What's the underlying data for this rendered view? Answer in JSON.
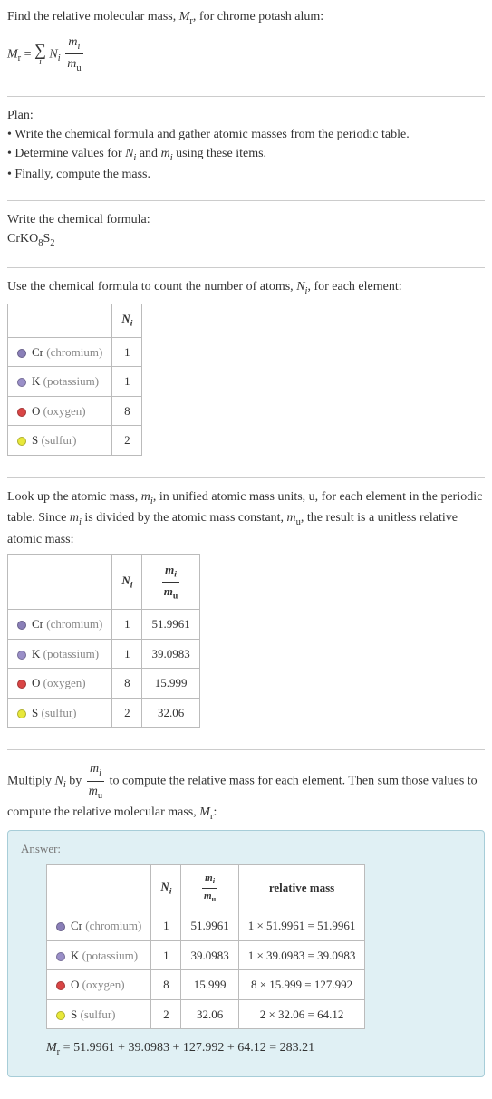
{
  "intro": {
    "line1_pre": "Find the relative molecular mass, ",
    "line1_var": "M",
    "line1_sub": "r",
    "line1_post": ", for chrome potash alum:"
  },
  "plan": {
    "heading": "Plan:",
    "item1": "• Write the chemical formula and gather atomic masses from the periodic table.",
    "item2_pre": "• Determine values for ",
    "item2_mid": " and ",
    "item2_post": " using these items.",
    "item3": "• Finally, compute the mass."
  },
  "chemformula": {
    "heading": "Write the chemical formula:",
    "formula_text": "CrKO",
    "sub1": "8",
    "s": "S",
    "sub2": "2"
  },
  "count_section": {
    "text_pre": "Use the chemical formula to count the number of atoms, ",
    "text_post": ", for each element:"
  },
  "elements": [
    {
      "sym": "Cr",
      "name": "(chromium)",
      "color": "#8a7fb8",
      "N": "1",
      "mass": "51.9961",
      "rel": "1 × 51.9961 = 51.9961"
    },
    {
      "sym": "K",
      "name": "(potassium)",
      "color": "#9a8fc8",
      "N": "1",
      "mass": "39.0983",
      "rel": "1 × 39.0983 = 39.0983"
    },
    {
      "sym": "O",
      "name": "(oxygen)",
      "color": "#d94545",
      "N": "8",
      "mass": "15.999",
      "rel": "8 × 15.999 = 127.992"
    },
    {
      "sym": "S",
      "name": "(sulfur)",
      "color": "#e8e83a",
      "N": "2",
      "mass": "32.06",
      "rel": "2 × 32.06 = 64.12"
    }
  ],
  "lookup_section": {
    "text_pre": "Look up the atomic mass, ",
    "text_mid1": ", in unified atomic mass units, u, for each element in the periodic table. Since ",
    "text_mid2": " is divided by the atomic mass constant, ",
    "text_post": ", the result is a unitless relative atomic mass:"
  },
  "multiply_section": {
    "text_pre": "Multiply ",
    "text_mid": " by ",
    "text_post1": " to compute the relative mass for each element. Then sum those values to compute the relative molecular mass, ",
    "text_post2": ":"
  },
  "answer": {
    "label": "Answer:",
    "rel_mass_header": "relative mass",
    "final": "= 51.9961 + 39.0983 + 127.992 + 64.12 = 283.21"
  },
  "vars": {
    "M": "M",
    "r": "r",
    "N": "N",
    "i": "i",
    "m": "m",
    "u": "u"
  }
}
